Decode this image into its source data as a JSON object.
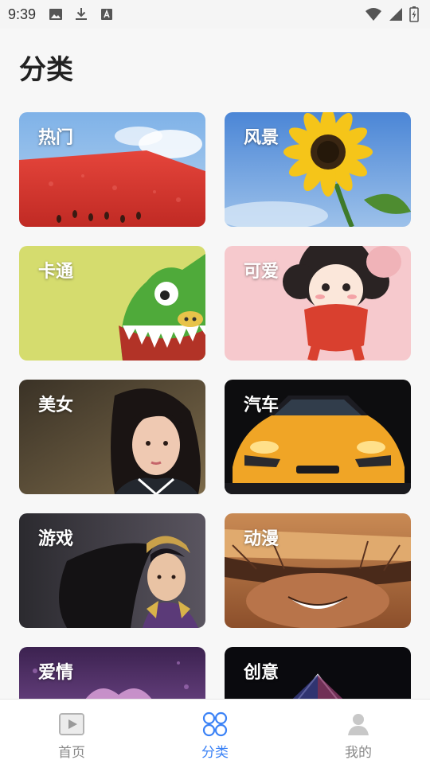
{
  "status_bar": {
    "time": "9:39",
    "left_icons": [
      "image-icon",
      "download-icon",
      "a-box-icon"
    ],
    "right_icons": [
      "wifi-icon",
      "signal-icon",
      "battery-icon"
    ]
  },
  "page": {
    "title": "分类"
  },
  "categories": [
    {
      "label": "热门",
      "image": "watermelon"
    },
    {
      "label": "风景",
      "image": "sunflower"
    },
    {
      "label": "卡通",
      "image": "green-monster"
    },
    {
      "label": "可爱",
      "image": "cartoon-girl"
    },
    {
      "label": "美女",
      "image": "woman-portrait"
    },
    {
      "label": "汽车",
      "image": "orange-sports-car"
    },
    {
      "label": "游戏",
      "image": "game-heroine"
    },
    {
      "label": "动漫",
      "image": "anime-face"
    },
    {
      "label": "爱情",
      "image": "purple-heart"
    },
    {
      "label": "创意",
      "image": "geometric-dome"
    }
  ],
  "bottom_nav": {
    "items": [
      {
        "label": "首页",
        "icon": "play-icon",
        "active": false
      },
      {
        "label": "分类",
        "icon": "grid-icon",
        "active": true
      },
      {
        "label": "我的",
        "icon": "user-icon",
        "active": false
      }
    ]
  },
  "colors": {
    "accent": "#3b82f6",
    "inactive": "#8a8a8a",
    "background": "#f7f7f7"
  }
}
